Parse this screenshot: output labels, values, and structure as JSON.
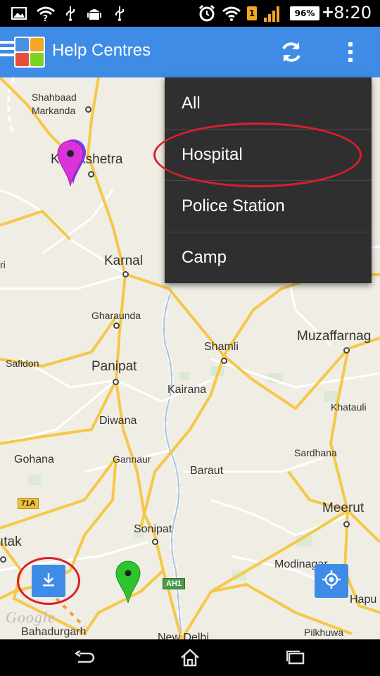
{
  "status_bar": {
    "time": "8:20",
    "battery_percent": "96%",
    "icons": [
      "image-icon",
      "wifi-question-icon",
      "usb-icon",
      "android-icon",
      "usb-icon",
      "alarm-icon",
      "wifi-icon",
      "notification-badge-icon",
      "signal-icon"
    ],
    "notification_badge": "1"
  },
  "action_bar": {
    "title": "Help Centres",
    "background": "#3e8ce6",
    "actions": [
      "refresh-icon",
      "overflow-menu-icon"
    ]
  },
  "menu": {
    "items": [
      {
        "label": "All"
      },
      {
        "label": "Hospital"
      },
      {
        "label": "Police Station"
      },
      {
        "label": "Camp"
      }
    ]
  },
  "map": {
    "places": {
      "shahbaad": "Shahbaad",
      "markanda": "Markanda",
      "kurukshetra": "Kurukshetra",
      "karnal": "Karnal",
      "gharaunda": "Gharaunda",
      "safidon": "Safidon",
      "panipat": "Panipat",
      "shamli": "Shamli",
      "muzaffarnagar": "Muzaffarnag",
      "kairana": "Kairana",
      "khatauli": "Khatauli",
      "diwana": "Diwana",
      "gohana": "Gohana",
      "gannaur": "Gannaur",
      "sardhana": "Sardhana",
      "baraut": "Baraut",
      "meerut": "Meerut",
      "sonipat": "Sonipat",
      "rohtak": "ıtak",
      "modinagar": "Modinagar",
      "hapur": "Hapu",
      "bahadurgarh": "Bahadurgarh",
      "pilkhuwa": "Pilkhuwa",
      "new_delhi": "New Delhi",
      "ri": "ri"
    },
    "shields": {
      "nh71a": "71A",
      "ah1": "AH1"
    },
    "watermark": "Google",
    "markers": [
      {
        "name": "pink-marker-icon",
        "color": "#d933d9"
      },
      {
        "name": "green-marker-icon",
        "color": "#2ec42e"
      }
    ],
    "buttons": {
      "download": "download-icon",
      "my_location": "my-location-icon"
    }
  },
  "nav_bar": {
    "buttons": [
      "back-icon",
      "home-icon",
      "recent-apps-icon"
    ]
  },
  "colors": {
    "accent": "#3e8ce6",
    "annotation": "#d9202b",
    "menu_bg": "#2f2f2f",
    "road_major": "#f5c84a",
    "road_minor": "#ffffff",
    "map_bg": "#f0ede5"
  }
}
